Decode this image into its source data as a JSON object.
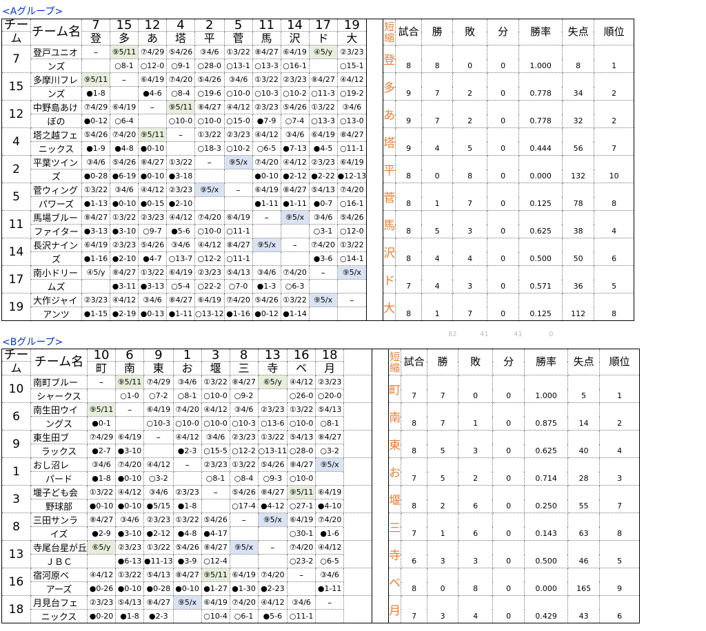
{
  "group_a": {
    "title": "<Aグループ>",
    "header": {
      "team_top": "チー",
      "team_bottom": "ム",
      "name_label": "チーム名",
      "numbers": [
        "7",
        "15",
        "12",
        "4",
        "2",
        "5",
        "11",
        "14",
        "17",
        "19"
      ],
      "abbrs": [
        "登",
        "多",
        "あ",
        "塔",
        "平",
        "菅",
        "馬",
        "沢",
        "ド",
        "大"
      ]
    },
    "teams": [
      {
        "num": "7",
        "name1": "登戸ユニオ",
        "name2": "ンズ",
        "abbr": "登",
        "games": "8",
        "wins": "8",
        "losses": "0",
        "draws": "0",
        "pct": "1.000",
        "runs_allowed": "8",
        "rank": "1",
        "top": [
          "–",
          "⑨5/11",
          "⑦4/29",
          "⑤4/26",
          "③4/6",
          "①3/22",
          "⑧4/27",
          "⑥4/19",
          "④5/y",
          "②3/23"
        ],
        "bottom": [
          "",
          "○8-1",
          "○12-0",
          "○9-1",
          "○28-0",
          "○13-1",
          "○13-3",
          "○16-1",
          "",
          "○15-1"
        ]
      },
      {
        "num": "15",
        "name1": "多摩川フレ",
        "name2": "ンズ",
        "abbr": "多",
        "games": "9",
        "wins": "7",
        "losses": "2",
        "draws": "0",
        "pct": "0.778",
        "runs_allowed": "34",
        "rank": "2",
        "top": [
          "⑨5/11",
          "–",
          "⑥4/19",
          "⑦4/20",
          "⑤4/26",
          "③4/6",
          "①3/22",
          "②3/23",
          "⑧4/27",
          "④4/12"
        ],
        "bottom": [
          "●1-8",
          "",
          "●4-6",
          "○8-4",
          "○19-6",
          "○10-0",
          "○10-3",
          "○10-2",
          "○11-3",
          "○19-2"
        ]
      },
      {
        "num": "12",
        "name1": "中野島あけ",
        "name2": "ぼの",
        "abbr": "あ",
        "games": "9",
        "wins": "7",
        "losses": "2",
        "draws": "0",
        "pct": "0.778",
        "runs_allowed": "32",
        "rank": "2",
        "top": [
          "⑦4/29",
          "⑥4/19",
          "–",
          "⑨5/11",
          "⑧4/27",
          "④4/12",
          "②3/23",
          "⑤4/26",
          "①3/22",
          "③4/6"
        ],
        "bottom": [
          "●0-12",
          "○6-4",
          "",
          "○10-0",
          "○10-0",
          "○15-0",
          "●7-9",
          "○7-4",
          "○13-3",
          "○13-0"
        ]
      },
      {
        "num": "4",
        "name1": "塔之越フェ",
        "name2": "ニックス",
        "abbr": "塔",
        "games": "9",
        "wins": "4",
        "losses": "5",
        "draws": "0",
        "pct": "0.444",
        "runs_allowed": "56",
        "rank": "7",
        "top": [
          "⑤4/26",
          "⑦4/20",
          "⑨5/11",
          "–",
          "①3/22",
          "②3/23",
          "④4/12",
          "③4/6",
          "⑥4/19",
          "⑧4/27"
        ],
        "bottom": [
          "●1-9",
          "●4-8",
          "●0-10",
          "",
          "○18-3",
          "○10-2",
          "○6-5",
          "●7-13",
          "●4-5",
          "○11-1"
        ]
      },
      {
        "num": "2",
        "name1": "平葉ツイン",
        "name2": "ズ",
        "abbr": "平",
        "games": "8",
        "wins": "0",
        "losses": "8",
        "draws": "0",
        "pct": "0.000",
        "runs_allowed": "132",
        "rank": "10",
        "top": [
          "③4/6",
          "⑤4/26",
          "⑧4/27",
          "①3/22",
          "–",
          "⑨5/x",
          "⑦4/20",
          "④4/12",
          "②3/23",
          "⑥4/19"
        ],
        "bottom": [
          "●0-28",
          "●6-19",
          "●0-10",
          "●3-18",
          "",
          "",
          "●0-10",
          "●2-12",
          "●2-22",
          "●12-13"
        ]
      },
      {
        "num": "5",
        "name1": "菅ウィング",
        "name2": "パワーズ",
        "abbr": "菅",
        "games": "8",
        "wins": "1",
        "losses": "7",
        "draws": "0",
        "pct": "0.125",
        "runs_allowed": "78",
        "rank": "8",
        "top": [
          "①3/22",
          "③4/6",
          "④4/12",
          "②3/23",
          "⑨5/x",
          "–",
          "⑥4/19",
          "⑧4/27",
          "⑤4/13",
          "⑦4/20"
        ],
        "bottom": [
          "●1-13",
          "●0-10",
          "●0-15",
          "●2-10",
          "",
          "",
          "●1-11",
          "●1-11",
          "●0-7",
          "○16-1"
        ]
      },
      {
        "num": "11",
        "name1": "馬場ブルー",
        "name2": "ファイター",
        "abbr": "馬",
        "games": "8",
        "wins": "5",
        "losses": "3",
        "draws": "0",
        "pct": "0.625",
        "runs_allowed": "38",
        "rank": "4",
        "top": [
          "⑧4/27",
          "①3/22",
          "②3/23",
          "④4/12",
          "⑦4/20",
          "⑥4/19",
          "–",
          "⑨5/x",
          "③4/6",
          "⑤4/26"
        ],
        "bottom": [
          "●3-13",
          "●3-10",
          "○9-7",
          "●5-6",
          "○10-0",
          "○11-1",
          "",
          "",
          "○3-1",
          "○12-0"
        ]
      },
      {
        "num": "14",
        "name1": "長沢ナイン",
        "name2": "ズ",
        "abbr": "沢",
        "games": "8",
        "wins": "4",
        "losses": "4",
        "draws": "0",
        "pct": "0.500",
        "runs_allowed": "50",
        "rank": "6",
        "top": [
          "⑥4/19",
          "②3/23",
          "⑤4/26",
          "③4/6",
          "④4/12",
          "⑧4/27",
          "⑨5/x",
          "–",
          "⑦4/20",
          "①3/22"
        ],
        "bottom": [
          "●1-16",
          "●2-10",
          "●4-7",
          "○13-7",
          "○12-2",
          "○11-1",
          "",
          "",
          "●3-6",
          "○14-1"
        ]
      },
      {
        "num": "17",
        "name1": "南小ドリー",
        "name2": "ムズ",
        "abbr": "ド",
        "games": "7",
        "wins": "4",
        "losses": "3",
        "draws": "0",
        "pct": "0.571",
        "runs_allowed": "36",
        "rank": "5",
        "top": [
          "④5/y",
          "⑧4/27",
          "①3/22",
          "⑥4/19",
          "②3/23",
          "⑤4/13",
          "③4/6",
          "⑦4/20",
          "–",
          "⑨5/x"
        ],
        "bottom": [
          "",
          "●3-11",
          "●3-13",
          "○5-4",
          "○22-2",
          "○7-0",
          "●1-3",
          "○6-3",
          "",
          ""
        ]
      },
      {
        "num": "19",
        "name1": "大作ジャイ",
        "name2": "アンツ",
        "abbr": "大",
        "games": "8",
        "wins": "1",
        "losses": "7",
        "draws": "0",
        "pct": "0.125",
        "runs_allowed": "112",
        "rank": "8",
        "top": [
          "②3/23",
          "④4/12",
          "③4/6",
          "⑧4/27",
          "⑥4/19",
          "⑦4/20",
          "⑤4/26",
          "①3/22",
          "⑨5/x",
          "–"
        ],
        "bottom": [
          "●1-15",
          "●2-19",
          "●0-13",
          "●1-11",
          "○13-12",
          "●1-16",
          "●0-12",
          "●1-14",
          "",
          ""
        ]
      }
    ],
    "totals": [
      "82",
      "41",
      "41",
      "0"
    ]
  },
  "group_b": {
    "title": "<Bグループ>",
    "header": {
      "team_top": "チー",
      "team_bottom": "ム",
      "name_label": "チーム名",
      "numbers": [
        "10",
        "6",
        "9",
        "1",
        "3",
        "8",
        "13",
        "16",
        "18"
      ],
      "abbrs": [
        "町",
        "南",
        "東",
        "お",
        "堰",
        "三",
        "寺",
        "ベ",
        "月"
      ]
    },
    "teams": [
      {
        "num": "10",
        "name1": "南町ブルー",
        "name2": "シャークス",
        "abbr": "町",
        "games": "7",
        "wins": "7",
        "losses": "0",
        "draws": "0",
        "pct": "1.000",
        "runs_allowed": "5",
        "rank": "1",
        "top": [
          "–",
          "⑨5/11",
          "⑦4/29",
          "③4/6",
          "①3/22",
          "⑧4/27",
          "⑥5/y",
          "④4/12",
          "②3/23"
        ],
        "bottom": [
          "",
          "○1-0",
          "○7-2",
          "○8-1",
          "○10-0",
          "○9-2",
          "",
          "○26-0",
          "○20-0"
        ]
      },
      {
        "num": "6",
        "name1": "南生田ウイ",
        "name2": "ングス",
        "abbr": "南",
        "games": "8",
        "wins": "7",
        "losses": "1",
        "draws": "0",
        "pct": "0.875",
        "runs_allowed": "14",
        "rank": "2",
        "top": [
          "⑨5/11",
          "–",
          "⑥4/19",
          "⑦4/20",
          "④4/12",
          "③4/6",
          "②3/23",
          "①3/22",
          "⑤4/13"
        ],
        "bottom": [
          "●0-1",
          "",
          "○10-3",
          "○10-0",
          "○10-0",
          "○10-3",
          "○13-6",
          "○10-0",
          "○8-1"
        ]
      },
      {
        "num": "9",
        "name1": "東生田ブ",
        "name2": "ラックス",
        "abbr": "東",
        "games": "8",
        "wins": "5",
        "losses": "3",
        "draws": "0",
        "pct": "0.625",
        "runs_allowed": "40",
        "rank": "4",
        "top": [
          "⑦4/29",
          "⑥4/19",
          "–",
          "④4/12",
          "③4/6",
          "②3/23",
          "①3/22",
          "⑤4/13",
          "⑧4/27"
        ],
        "bottom": [
          "●2-7",
          "●3-10",
          "",
          "●2-3",
          "○15-5",
          "○12-2",
          "○13-11",
          "○28-0",
          "○3-2"
        ]
      },
      {
        "num": "1",
        "name1": "おし沼レ",
        "name2": "パード",
        "abbr": "お",
        "games": "7",
        "wins": "5",
        "losses": "2",
        "draws": "0",
        "pct": "0.714",
        "runs_allowed": "28",
        "rank": "3",
        "top": [
          "③4/6",
          "⑦4/20",
          "④4/12",
          "–",
          "②3/23",
          "①3/22",
          "⑤4/26",
          "⑧4/27",
          "⑨5/x"
        ],
        "bottom": [
          "●1-8",
          "●0-10",
          "○3-2",
          "",
          "○8-1",
          "○8-4",
          "○9-3",
          "○10-0",
          ""
        ]
      },
      {
        "num": "3",
        "name1": "堰子ども会",
        "name2": "野球部",
        "abbr": "堰",
        "games": "8",
        "wins": "2",
        "losses": "6",
        "draws": "0",
        "pct": "0.250",
        "runs_allowed": "55",
        "rank": "7",
        "top": [
          "①3/22",
          "④4/12",
          "③4/6",
          "②3/23",
          "–",
          "⑤4/26",
          "⑧4/27",
          "⑨5/11",
          "⑥4/19"
        ],
        "bottom": [
          "●0-10",
          "●0-10",
          "●5/15",
          "●1-8",
          "",
          "○17-4",
          "●4-12",
          "○27-1",
          "●4-10"
        ]
      },
      {
        "num": "8",
        "name1": "三田サンラ",
        "name2": "イズ",
        "abbr": "三",
        "games": "7",
        "wins": "1",
        "losses": "6",
        "draws": "0",
        "pct": "0.143",
        "runs_allowed": "63",
        "rank": "8",
        "top": [
          "⑧4/27",
          "③4/6",
          "②3/23",
          "①3/22",
          "⑤4/26",
          "–",
          "⑨5/x",
          "⑥4/19",
          "⑦4/20"
        ],
        "bottom": [
          "●2-9",
          "●3-10",
          "●2-12",
          "●4-8",
          "●4-17",
          "",
          "",
          "○30-1",
          "●1-6"
        ]
      },
      {
        "num": "13",
        "name1": "寺尾台星が丘",
        "name2": "ＪＢＣ",
        "abbr": "寺",
        "games": "6",
        "wins": "3",
        "losses": "3",
        "draws": "0",
        "pct": "0.500",
        "runs_allowed": "46",
        "rank": "5",
        "top": [
          "⑥5/y",
          "②3/23",
          "①3/22",
          "⑤4/26",
          "⑧4/27",
          "⑨5/x",
          "–",
          "⑦4/20",
          "④4/12"
        ],
        "bottom": [
          "",
          "●6-13",
          "●11-13",
          "●3-9",
          "○12-4",
          "",
          "",
          "○23-2",
          "○6-5"
        ]
      },
      {
        "num": "16",
        "name1": "宿河原ベ",
        "name2": "アーズ",
        "abbr": "ベ",
        "games": "8",
        "wins": "0",
        "losses": "8",
        "draws": "0",
        "pct": "0.000",
        "runs_allowed": "165",
        "rank": "9",
        "top": [
          "④4/12",
          "①3/22",
          "⑤4/13",
          "⑧4/27",
          "⑨5/11",
          "⑥4/19",
          "⑦4/20",
          "–",
          "③4/6"
        ],
        "bottom": [
          "●0-26",
          "●0-10",
          "●0-28",
          "●0-10",
          "●1-27",
          "●1-30",
          "●2-23",
          "",
          "●1-11"
        ]
      },
      {
        "num": "18",
        "name1": "月見台フェ",
        "name2": "ニックス",
        "abbr": "月",
        "games": "7",
        "wins": "3",
        "losses": "4",
        "draws": "0",
        "pct": "0.429",
        "runs_allowed": "43",
        "rank": "6",
        "top": [
          "②3/23",
          "⑤4/13",
          "⑧4/27",
          "⑨5/x",
          "⑥4/19",
          "⑦4/20",
          "④4/12",
          "③4/6",
          "–"
        ],
        "bottom": [
          "●0-20",
          "●1-8",
          "●2-3",
          "",
          "○10-4",
          "○6-1",
          "●5-6",
          "○11-1",
          ""
        ]
      }
    ]
  },
  "stats_header": {
    "abbr_top": "短",
    "abbr_bottom": "縮",
    "games": "試合",
    "wins": "勝",
    "losses": "敗",
    "draws": "分",
    "pct": "勝率",
    "runs_allowed": "失点",
    "rank": "順位"
  },
  "colors": {
    "group_title": "#0033cc",
    "abbr": "#ed7d31",
    "home_highlight": "#e7efdc",
    "pending_highlight": "#dae3f3",
    "future_highlight": "#e7e7e7"
  }
}
